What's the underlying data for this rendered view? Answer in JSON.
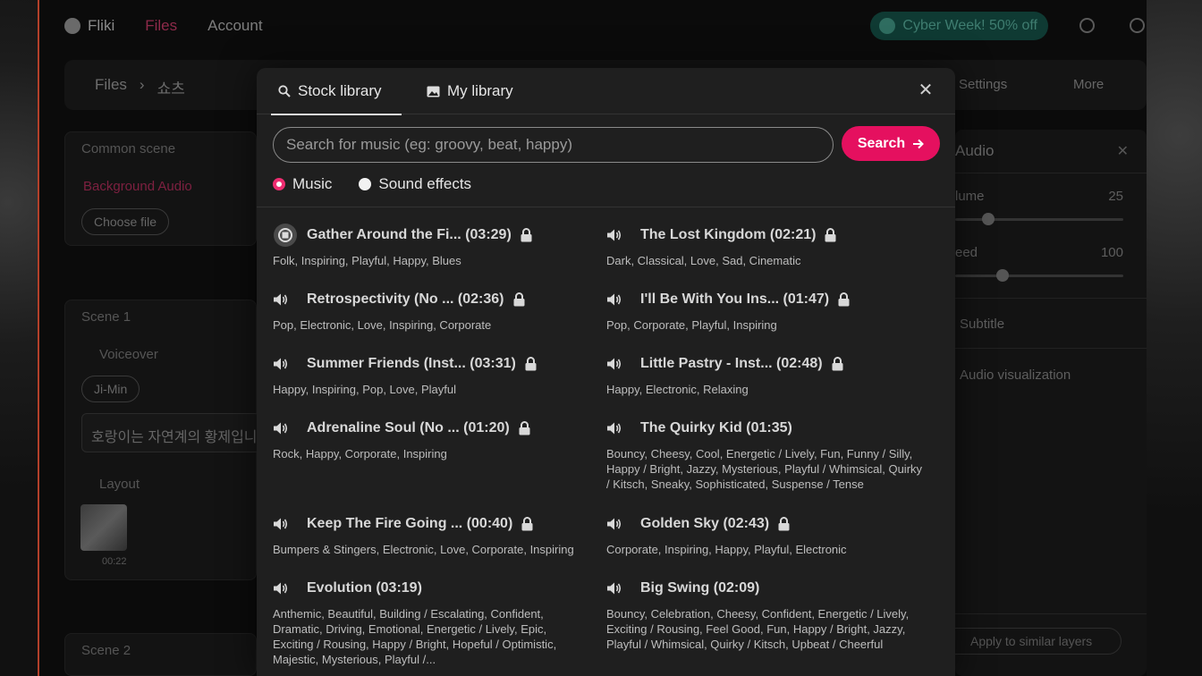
{
  "app": {
    "brand": "Fliki",
    "nav": [
      "Files",
      "Account"
    ],
    "promo": "Cyber Week! 50% off"
  },
  "breadcrumb": {
    "root": "Files",
    "separator": "›",
    "current": "쇼츠",
    "settings": "Settings",
    "more": "More"
  },
  "left": {
    "common_scene": "Common scene",
    "background_audio": "Background Audio",
    "choose_file": "Choose file",
    "scene1": "Scene 1",
    "voiceover": "Voiceover",
    "voice_name": "Ji-Min",
    "script_text": "호랑이는 자연계의 황제입니",
    "layout": "Layout",
    "thumb_time": "00:22",
    "scene2": "Scene 2"
  },
  "right": {
    "title": "Audio",
    "volume_label": "lume",
    "volume_value": "25",
    "volume_level_percent": 25,
    "speed_label": "eed",
    "speed_value": "100",
    "speed_level_percent": 33,
    "subtitle": "Subtitle",
    "audio_viz": "Audio visualization",
    "apply_similar": "Apply to similar layers"
  },
  "modal": {
    "tabs": [
      "Stock library",
      "My library"
    ],
    "search_placeholder": "Search for music (eg: groovy, beat, happy)",
    "search_button": "Search",
    "radio_music": "Music",
    "radio_sfx": "Sound effects",
    "tracks": [
      {
        "title": "Gather Around the Fi... (03:29)",
        "tags": "Folk, Inspiring, Playful, Happy, Blues",
        "locked": true,
        "playing": true
      },
      {
        "title": "The Lost Kingdom (02:21)",
        "tags": "Dark, Classical, Love, Sad, Cinematic",
        "locked": true
      },
      {
        "title": "Retrospectivity (No ... (02:36)",
        "tags": "Pop, Electronic, Love, Inspiring, Corporate",
        "locked": true
      },
      {
        "title": "I'll Be With You Ins... (01:47)",
        "tags": "Pop, Corporate, Playful, Inspiring",
        "locked": true
      },
      {
        "title": "Summer Friends (Inst... (03:31)",
        "tags": "Happy, Inspiring, Pop, Love, Playful",
        "locked": true
      },
      {
        "title": "Little Pastry - Inst... (02:48)",
        "tags": "Happy, Electronic, Relaxing",
        "locked": true
      },
      {
        "title": "Adrenaline Soul (No ... (01:20)",
        "tags": "Rock, Happy, Corporate, Inspiring",
        "locked": true
      },
      {
        "title": "The Quirky Kid (01:35)",
        "tags": "Bouncy, Cheesy, Cool, Energetic / Lively, Fun, Funny / Silly, Happy / Bright, Jazzy, Mysterious, Playful / Whimsical, Quirky / Kitsch, Sneaky, Sophisticated, Suspense / Tense",
        "locked": false
      },
      {
        "title": "Keep The Fire Going ... (00:40)",
        "tags": "Bumpers & Stingers, Electronic, Love, Corporate, Inspiring",
        "locked": true
      },
      {
        "title": "Golden Sky (02:43)",
        "tags": "Corporate, Inspiring, Happy, Playful, Electronic",
        "locked": true
      },
      {
        "title": "Evolution (03:19)",
        "tags": "Anthemic, Beautiful, Building / Escalating, Confident, Dramatic, Driving, Emotional, Energetic / Lively, Epic, Exciting / Rousing, Happy / Bright, Hopeful / Optimistic, Majestic, Mysterious, Playful /...",
        "locked": false
      },
      {
        "title": "Big Swing (02:09)",
        "tags": "Bouncy, Celebration, Cheesy, Confident, Energetic / Lively, Exciting / Rousing, Feel Good, Fun, Happy / Bright, Jazzy, Playful / Whimsical, Quirky / Kitsch, Upbeat / Cheerful",
        "locked": false
      }
    ]
  },
  "colors": {
    "accent": "#e5105f",
    "radio_on": "#ee2c70",
    "modal_bg": "#1f1f1f"
  }
}
